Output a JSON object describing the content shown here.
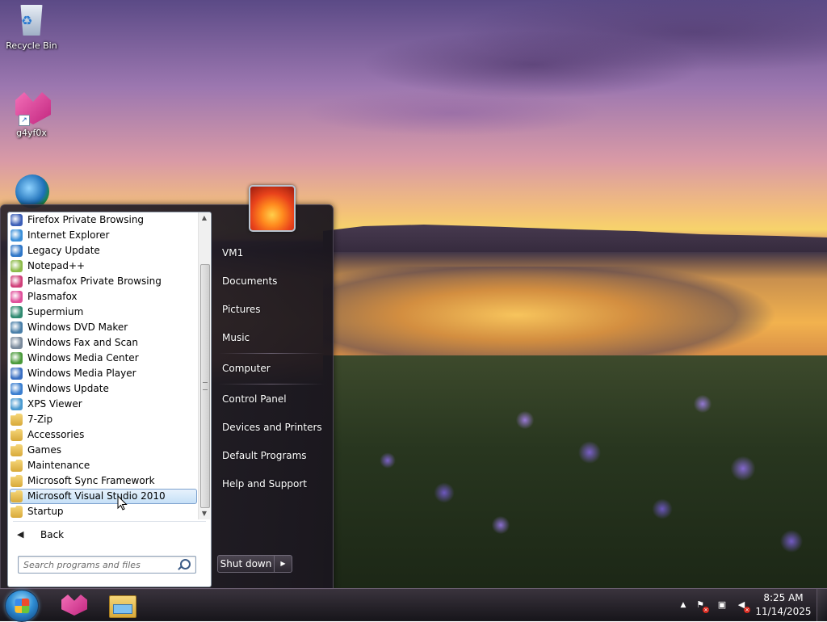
{
  "desktop": {
    "icons": [
      {
        "label": "Recycle Bin",
        "icon": "recycle-bin-icon"
      },
      {
        "label": "g4yf0x",
        "icon": "plasmafox-icon"
      },
      {
        "label": "",
        "icon": "supermium-icon"
      }
    ]
  },
  "start_menu": {
    "programs": [
      {
        "label": "Firefox Private Browsing",
        "icon": "firefox-private-icon",
        "color": "#3c5fb8"
      },
      {
        "label": "Internet Explorer",
        "icon": "internet-explorer-icon",
        "color": "#3a8fd9"
      },
      {
        "label": "Legacy Update",
        "icon": "legacy-update-icon",
        "color": "#2f77c8"
      },
      {
        "label": "Notepad++",
        "icon": "notepadpp-icon",
        "color": "#8dbb4a"
      },
      {
        "label": "Plasmafox Private Browsing",
        "icon": "plasmafox-private-icon",
        "color": "#d0407a"
      },
      {
        "label": "Plasmafox",
        "icon": "plasmafox-icon",
        "color": "#e0509b"
      },
      {
        "label": "Supermium",
        "icon": "supermium-icon",
        "color": "#2f8a70"
      },
      {
        "label": "Windows DVD Maker",
        "icon": "dvd-maker-icon",
        "color": "#4a7fa8"
      },
      {
        "label": "Windows Fax and Scan",
        "icon": "fax-scan-icon",
        "color": "#7a8a9c"
      },
      {
        "label": "Windows Media Center",
        "icon": "media-center-icon",
        "color": "#4a9a3a"
      },
      {
        "label": "Windows Media Player",
        "icon": "media-player-icon",
        "color": "#3a6fc2"
      },
      {
        "label": "Windows Update",
        "icon": "windows-update-icon",
        "color": "#3b7fd0"
      },
      {
        "label": "XPS Viewer",
        "icon": "xps-viewer-icon",
        "color": "#4a9ad0"
      },
      {
        "label": "7-Zip",
        "icon": "folder-icon",
        "color": "#d8a93a"
      },
      {
        "label": "Accessories",
        "icon": "folder-icon",
        "color": "#d8a93a"
      },
      {
        "label": "Games",
        "icon": "folder-icon",
        "color": "#d8a93a"
      },
      {
        "label": "Maintenance",
        "icon": "folder-icon",
        "color": "#d8a93a"
      },
      {
        "label": "Microsoft Sync Framework",
        "icon": "folder-icon",
        "color": "#d8a93a"
      },
      {
        "label": "Microsoft Visual Studio 2010",
        "icon": "folder-icon",
        "color": "#d8a93a",
        "selected": true
      },
      {
        "label": "Startup",
        "icon": "folder-icon",
        "color": "#d8a93a"
      }
    ],
    "back_label": "Back",
    "search_placeholder": "Search programs and files",
    "right_pane": {
      "username": "VM1",
      "items": [
        "Documents",
        "Pictures",
        "Music",
        "Computer",
        "Control Panel",
        "Devices and Printers",
        "Default Programs",
        "Help and Support"
      ]
    },
    "shutdown_label": "Shut down"
  },
  "taskbar": {
    "pinned": [
      {
        "name": "plasmafox",
        "icon": "plasmafox-icon"
      },
      {
        "name": "windows-explorer",
        "icon": "windows-explorer-icon"
      }
    ],
    "clock": {
      "time": "8:25 AM",
      "date": "11/14/2025"
    }
  }
}
